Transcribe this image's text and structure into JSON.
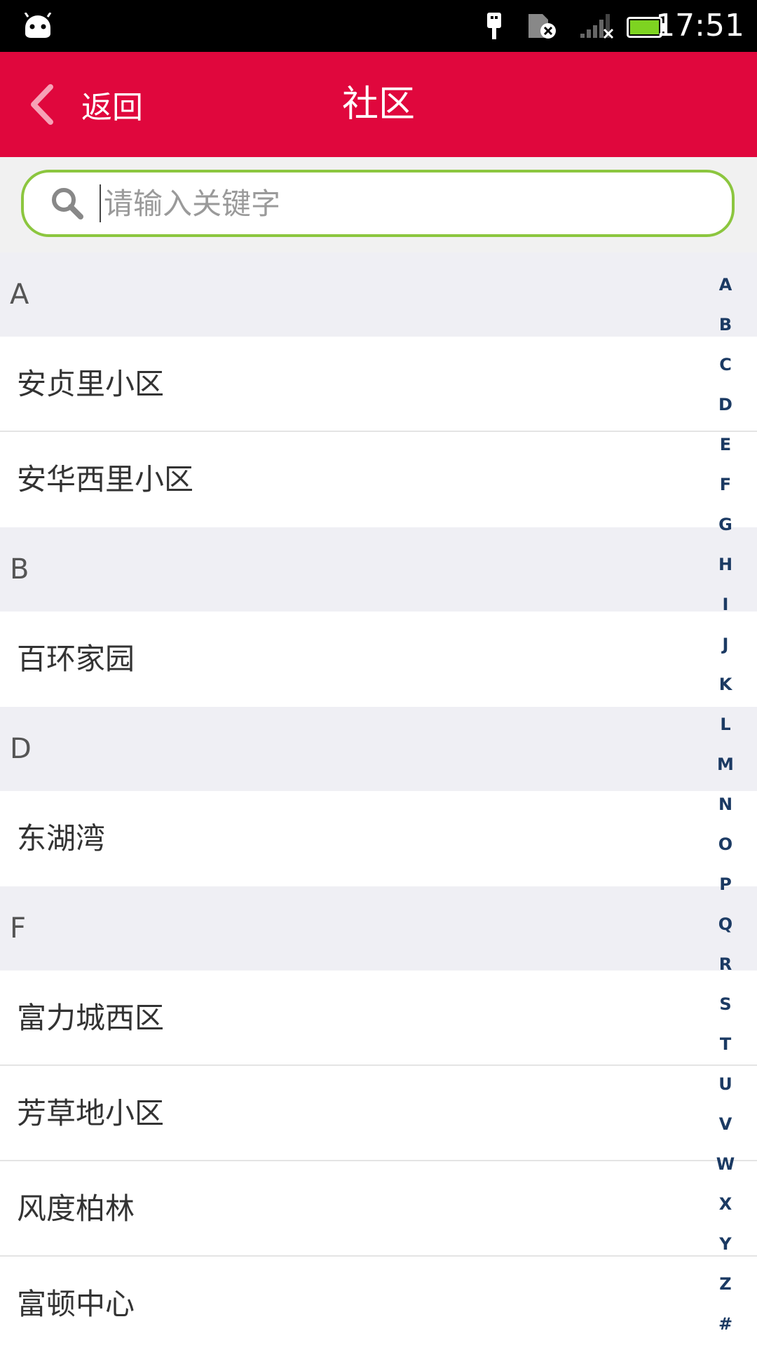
{
  "status_bar": {
    "time": "17:51",
    "icons": [
      "android-icon",
      "usb-icon",
      "sim-card-off-icon",
      "signal-weak-icon",
      "battery-full-icon"
    ],
    "battery_color": "#7ed321"
  },
  "header": {
    "back_label": "返回",
    "title": "社区",
    "background_color": "#e0073d"
  },
  "search": {
    "placeholder": "请输入关键字",
    "value": "",
    "border_color": "#8cc63f"
  },
  "sections": [
    {
      "letter": "A",
      "items": [
        "安贞里小区",
        "安华西里小区"
      ]
    },
    {
      "letter": "B",
      "items": [
        "百环家园"
      ]
    },
    {
      "letter": "D",
      "items": [
        "东湖湾"
      ]
    },
    {
      "letter": "F",
      "items": [
        "富力城西区",
        "芳草地小区",
        "风度柏林",
        "富顿中心"
      ]
    }
  ],
  "alphabet_index": [
    "A",
    "B",
    "C",
    "D",
    "E",
    "F",
    "G",
    "H",
    "I",
    "J",
    "K",
    "L",
    "M",
    "N",
    "O",
    "P",
    "Q",
    "R",
    "S",
    "T",
    "U",
    "V",
    "W",
    "X",
    "Y",
    "Z",
    "#"
  ]
}
